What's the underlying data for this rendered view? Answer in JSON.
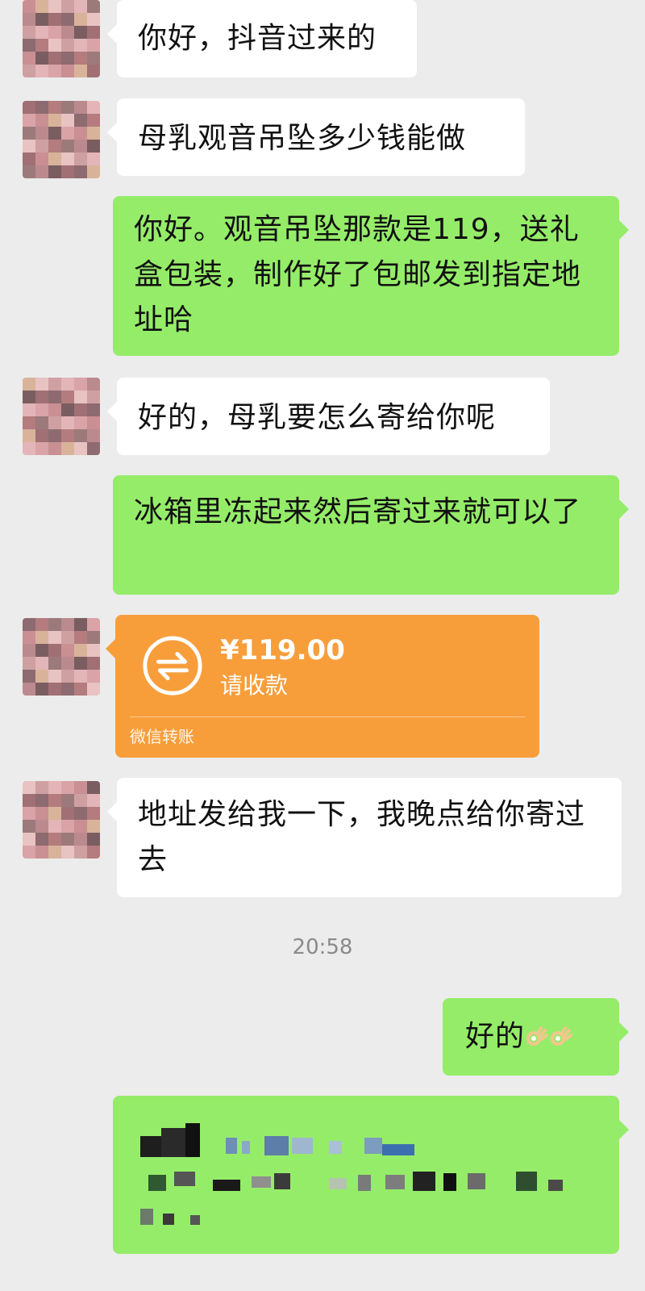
{
  "messages": [
    {
      "sender": "contact",
      "text": "你好，抖音过来的"
    },
    {
      "sender": "contact",
      "text": "母乳观音吊坠多少钱能做"
    },
    {
      "sender": "me",
      "text": "你好。观音吊坠那款是119，送礼盒包装，制作好了包邮发到指定地址哈"
    },
    {
      "sender": "contact",
      "text": "好的，母乳要怎么寄给你呢"
    },
    {
      "sender": "me",
      "text": "冰箱里冻起来然后寄过来就可以了"
    },
    {
      "sender": "contact",
      "type": "transfer",
      "amount": "¥119.00",
      "status": "请收款",
      "footer": "微信转账"
    },
    {
      "sender": "contact",
      "text": "地址发给我一下，我晚点给你寄过去"
    },
    {
      "type": "timestamp",
      "text": "20:58"
    },
    {
      "sender": "me",
      "text": "好的",
      "emoji": [
        "ok-hand-emoji",
        "ok-hand-emoji"
      ]
    },
    {
      "sender": "me",
      "type": "redacted-address"
    }
  ],
  "colors": {
    "background": "#ececec",
    "incoming_bubble": "#ffffff",
    "outgoing_bubble": "#95ec69",
    "transfer_card": "#f79e3b",
    "timestamp": "#8a8a8a"
  },
  "icons": {
    "transfer": "transfer-arrows-icon",
    "emoji": "ok-hand-emoji"
  }
}
